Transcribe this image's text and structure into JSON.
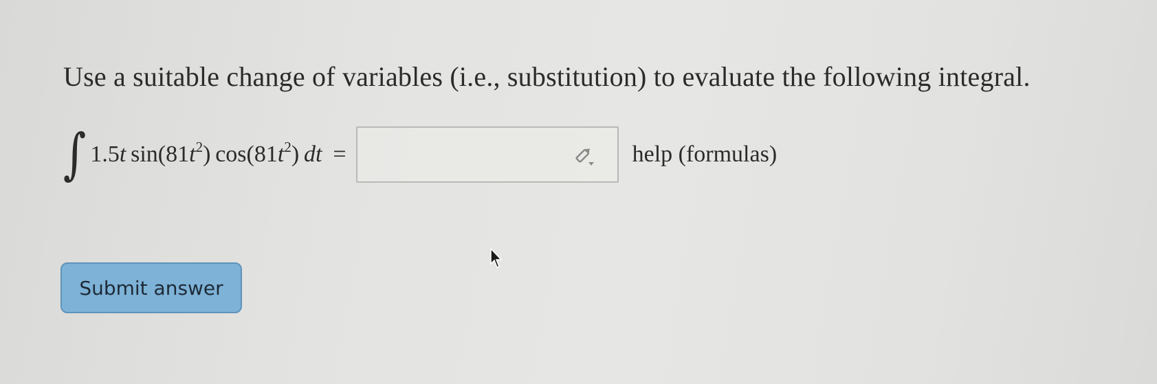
{
  "problem": {
    "instruction": "Use a suitable change of variables (i.e., substitution) to evaluate the following integral."
  },
  "equation": {
    "integral_symbol": "∫",
    "coefficient": "1.5",
    "var_t": "t",
    "sin_fn": "sin",
    "cos_fn": "cos",
    "inner_coef": "81",
    "exponent": "2",
    "differential": "dt",
    "equals": "="
  },
  "answer": {
    "value": "",
    "placeholder": ""
  },
  "help": {
    "label": "help (formulas)"
  },
  "submit": {
    "label": "Submit answer"
  }
}
